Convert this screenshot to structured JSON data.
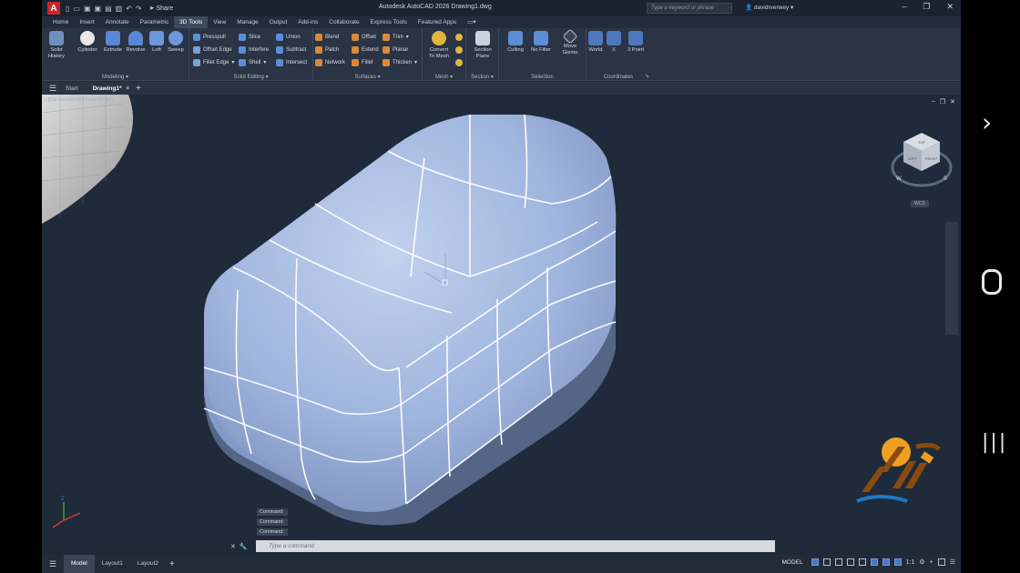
{
  "app": {
    "logo_letter": "A",
    "title": "Autodesk AutoCAD 2026   Drawing1.dwg",
    "share_label": "Share",
    "search_placeholder": "Type a keyword or phrase",
    "username": "davidrverwey"
  },
  "ribbon_tabs": [
    "Home",
    "Insert",
    "Annotate",
    "Parametric",
    "3D Tools",
    "View",
    "Manage",
    "Output",
    "Add-ins",
    "Collaborate",
    "Express Tools",
    "Featured Apps"
  ],
  "active_tab": "3D Tools",
  "ribbon": {
    "modeling": {
      "label": "Modeling",
      "buttons": [
        "Solid\nHistory",
        "Cylinder",
        "Extrude",
        "Revolve",
        "Loft",
        "Sweep"
      ]
    },
    "solid_editing": {
      "label": "Solid Editing",
      "items": [
        "Presspull",
        "Offset Edge",
        "Fillet Edge",
        "Slice",
        "Interfere",
        "Shell",
        "Union",
        "Subtract",
        "Intersect"
      ]
    },
    "surfaces": {
      "label": "Surfaces",
      "items": [
        "Blend",
        "Patch",
        "Network",
        "Offset",
        "Extend",
        "Fillet",
        "Trim",
        "Planar",
        "Thicken"
      ]
    },
    "mesh": {
      "label": "Mesh",
      "button": "Convert\nTo Mesh"
    },
    "section": {
      "label": "Section",
      "button": "Section\nPlane"
    },
    "selection": {
      "label": "Selection",
      "buttons": [
        "Culling",
        "No Filter",
        "Move\nGizmo"
      ]
    },
    "coordinates": {
      "label": "Coordinates",
      "buttons": [
        "World",
        "X",
        "3 Point"
      ]
    }
  },
  "doc_tabs": {
    "start": "Start",
    "drawing": "Drawing1*"
  },
  "viewport": {
    "label": "[-][SE Isometric][Shaded][Fast]",
    "wcs": "WCS",
    "viewcube_faces": [
      "TOP",
      "LEFT",
      "FRONT"
    ],
    "compass": [
      "W",
      "S"
    ],
    "command_history": [
      "Command:",
      "Command:",
      "Command:"
    ]
  },
  "command_input": {
    "placeholder": "Type a command"
  },
  "status": {
    "layout_tabs": [
      "Model",
      "Layout1",
      "Layout2"
    ],
    "active_layout": "Model",
    "mode": "MODEL",
    "scale": "1:1"
  },
  "colors": {
    "accent": "#4a77c4",
    "solid": "#a8bde0",
    "background": "#1f2b3a"
  }
}
